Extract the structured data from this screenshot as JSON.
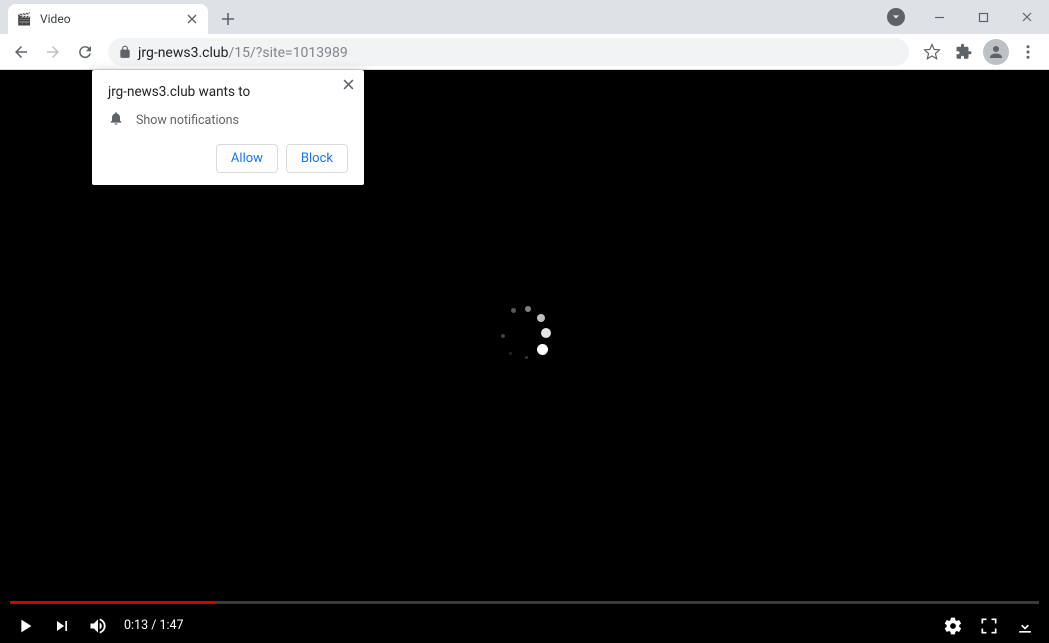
{
  "tab": {
    "title": "Video",
    "favicon": "🎬"
  },
  "url": {
    "host": "jrg-news3.club",
    "path": "/15/?site=1013989"
  },
  "notification": {
    "title": "jrg-news3.club wants to",
    "permission": "Show notifications",
    "allow": "Allow",
    "block": "Block"
  },
  "player": {
    "current_time": "0:13",
    "duration": "1:47",
    "progress_percent": 20
  }
}
